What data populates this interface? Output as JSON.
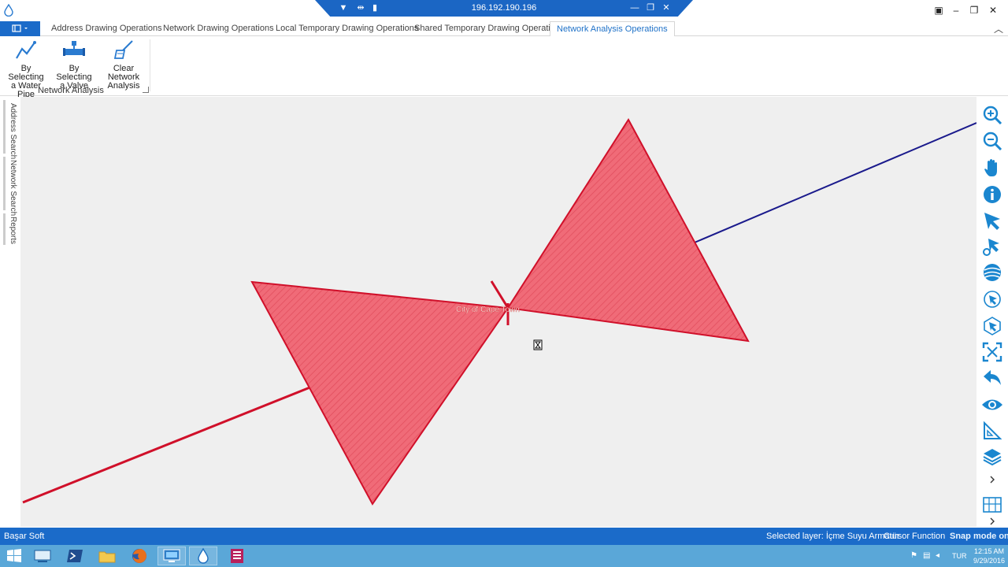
{
  "remote": {
    "host": "196.192.190.196"
  },
  "ribbon": {
    "tabs": [
      {
        "label": "Address Drawing Operations",
        "active": false
      },
      {
        "label": "Network Drawing Operations",
        "active": false
      },
      {
        "label": "Local Temporary Drawing Operations",
        "active": false
      },
      {
        "label": "Shared Temporary Drawing Operations",
        "active": false
      },
      {
        "label": "Network Analysis Operations",
        "active": true
      }
    ],
    "buttons": [
      {
        "line1": "By Selecting",
        "line2": "a Water Pipe",
        "icon": "water-pipe-icon"
      },
      {
        "line1": "By Selecting",
        "line2": "a Valve",
        "icon": "valve-icon"
      },
      {
        "line1": "Clear Network",
        "line2": "Analysis",
        "icon": "clear-brush-icon"
      }
    ],
    "group_label": "Network Analysis"
  },
  "side_tabs": [
    "Address Search",
    "Network Search",
    "Reports"
  ],
  "map": {
    "feature_label": "City of Cape Town",
    "colors": {
      "polygon_fill": "#f06b78",
      "polygon_stroke": "#d0102a",
      "line_red": "#d0102a",
      "line_blue": "#1a1a8c",
      "background": "#efefef"
    }
  },
  "tools": [
    "zoom-in-icon",
    "zoom-out-icon",
    "pan-hand-icon",
    "info-icon",
    "select-arrow-icon",
    "select-edit-icon",
    "globe-icon",
    "select-circle-icon",
    "select-hex-icon",
    "zoom-extent-icon",
    "undo-arrow-icon",
    "eye-icon",
    "measure-triangle-icon",
    "layers-icon",
    "chevron-right-icon",
    "map-grid-icon",
    "chevron-right-icon"
  ],
  "status": {
    "company": "Başar Soft",
    "selected_layer": "Selected layer: İçme Suyu Armatür",
    "cursor_function": "Cursor Function",
    "snap": "Snap mode on"
  },
  "taskbar": {
    "apps": [
      "start-icon",
      "server-manager-icon",
      "powershell-icon",
      "file-explorer-icon",
      "firefox-icon",
      "remote-desktop-icon",
      "water-app-icon",
      "database-icon"
    ],
    "language": "TUR",
    "time": "12:15 AM",
    "date": "9/29/2016"
  },
  "accent": "#1b6bc9"
}
